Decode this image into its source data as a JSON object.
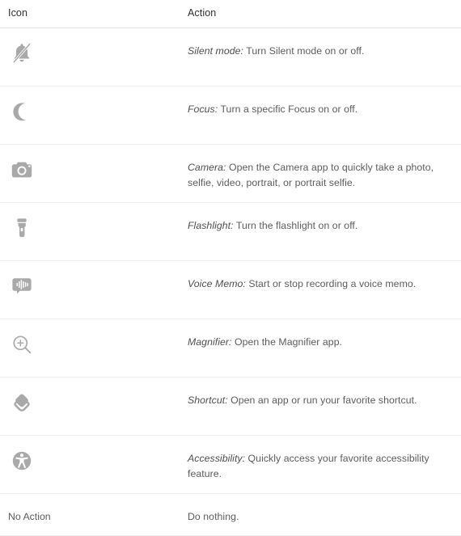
{
  "table": {
    "columns": [
      {
        "key": "icon",
        "label": "Icon"
      },
      {
        "key": "action",
        "label": "Action"
      }
    ],
    "rows": [
      {
        "icon_name": "bell-slash-icon",
        "icon_alt": "Silent mode bell with slash",
        "label": "Silent mode:",
        "description": " Turn Silent mode on or off."
      },
      {
        "icon_name": "crescent-moon-icon",
        "icon_alt": "Focus crescent moon",
        "label": "Focus:",
        "description": " Turn a specific Focus on or off."
      },
      {
        "icon_name": "camera-icon",
        "icon_alt": "Camera body with lens",
        "label": "Camera:",
        "description": " Open the Camera app to quickly take a photo, selfie, video, portrait, or portrait selfie."
      },
      {
        "icon_name": "flashlight-icon",
        "icon_alt": "Flashlight torch",
        "label": "Flashlight:",
        "description": " Turn the flashlight on or off."
      },
      {
        "icon_name": "voice-memo-icon",
        "icon_alt": "Speech bubble with audio waveform",
        "label": "Voice Memo:",
        "description": " Start or stop recording a voice memo."
      },
      {
        "icon_name": "magnifier-icon",
        "icon_alt": "Magnifying glass with plus sign",
        "label": "Magnifier:",
        "description": " Open the Magnifier app."
      },
      {
        "icon_name": "shortcut-icon",
        "icon_alt": "Stacked layers shortcut",
        "label": "Shortcut:",
        "description": " Open an app or run your favorite shortcut."
      },
      {
        "icon_name": "accessibility-icon",
        "icon_alt": "Accessibility person in circle",
        "label": "Accessibility:",
        "description": " Quickly access your favorite accessibility feature."
      }
    ],
    "no_action_row": {
      "icon_text": "No Action",
      "description": "Do nothing."
    }
  },
  "colors": {
    "icon_gray": "#a8a8a8",
    "text_gray": "#5d5d5d",
    "header_text": "#2f2f2f",
    "divider": "#ededed",
    "background": "#ffffff"
  }
}
